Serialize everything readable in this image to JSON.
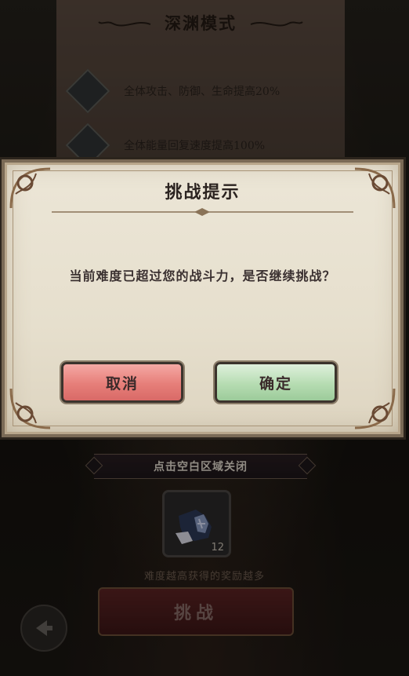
{
  "mode_panel": {
    "title": "深渊模式",
    "buffs": [
      {
        "icon": "warrior-emblem-icon",
        "text": "全体攻击、防御、生命提高20%"
      },
      {
        "icon": "energy-emblem-icon",
        "text": "全体能量回复速度提高100%"
      }
    ]
  },
  "dialog": {
    "title": "挑战提示",
    "message": "当前难度已超过您的战斗力，是否继续挑战？",
    "cancel_label": "取消",
    "confirm_label": "确定"
  },
  "footer": {
    "close_hint": "点击空白区域关闭",
    "reward_item_count": "12",
    "reward_note": "难度越高获得的奖励越多",
    "challenge_label": "挑战"
  },
  "colors": {
    "cancel_button": "#e67e79",
    "confirm_button": "#b6dcb2",
    "dialog_background": "#e9e3d3",
    "frame": "#7a6a56"
  }
}
